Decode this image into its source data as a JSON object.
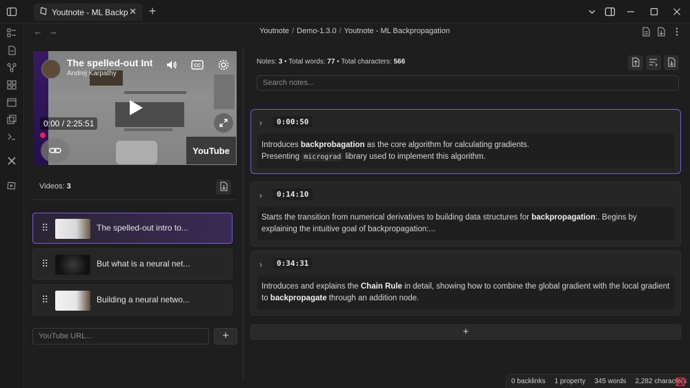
{
  "tab": {
    "title": "Youtnote - ML Backpro..."
  },
  "breadcrumb": {
    "items": [
      "Youtnote",
      "Demo-1.3.0",
      "Youtnote - ML Backpropagation"
    ]
  },
  "video": {
    "title": "The spelled-out Intr",
    "author": "Andrej Karpathy",
    "time": "0:00 / 2:25:51",
    "watermark": "YouTube"
  },
  "videos": {
    "label": "Videos:",
    "count": "3",
    "items": [
      {
        "title": "The spelled-out intro to..."
      },
      {
        "title": "But what is a neural net..."
      },
      {
        "title": "Building a neural netwo..."
      }
    ]
  },
  "url_input": {
    "placeholder": "YouTube URL..."
  },
  "add_button": "+",
  "stats": {
    "notes_label": "Notes:",
    "notes": "3",
    "words_label": "Total words:",
    "words": "77",
    "chars_label": "Total characters:",
    "chars": "566"
  },
  "search": {
    "placeholder": "Search notes..."
  },
  "notes": [
    {
      "time": "0:00:50"
    },
    {
      "time": "0:14:10"
    },
    {
      "time": "0:34:31"
    }
  ],
  "note_texts": {
    "n1_a": "Introduces ",
    "n1_b": "backprobagation",
    "n1_c": " as the core algorithm for calculating gradients.",
    "n1_d": "Presenting ",
    "n1_e": "micrograd",
    "n1_f": " library used to implement this algorithm.",
    "n2_a": "Starts the transition from numerical derivatives to building data structures for ",
    "n2_b": "backpropagation",
    "n2_c": ":. Begins by explaining the intuitive goal of backpropagation:...",
    "n3_a": "Introduces and explains the ",
    "n3_b": "Chain Rule",
    "n3_c": " in detail, showing how to combine the global gradient with the local gradient to ",
    "n3_d": "backpropagate",
    "n3_e": " through an addition node."
  },
  "status": {
    "backlinks": "0 backlinks",
    "property": "1 property",
    "words": "345 words",
    "characters": "2,282 characters"
  },
  "colors": {
    "accent": "#7b5bd0",
    "background": "#1e1e1e",
    "status_icon": "#e0334a"
  }
}
